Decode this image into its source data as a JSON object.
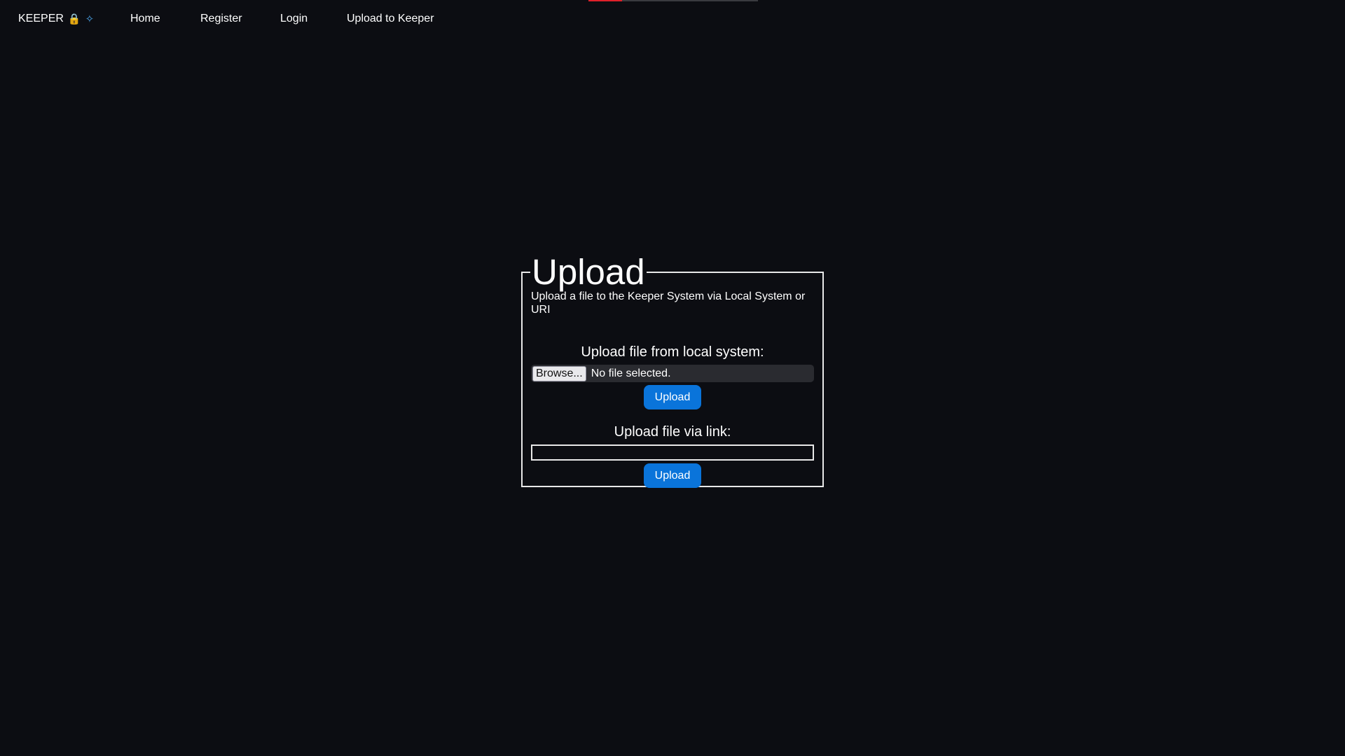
{
  "nav": {
    "brand": "KEEPER",
    "brand_icons": [
      "lock-icon",
      "paintbrush-icon"
    ],
    "links": [
      "Home",
      "Register",
      "Login",
      "Upload to Keeper"
    ]
  },
  "upload": {
    "title": "Upload",
    "description": "Upload a file to the Keeper System via Local System or URI",
    "local": {
      "label": "Upload file from local system:",
      "browse_label": "Browse...",
      "file_status": "No file selected.",
      "button_label": "Upload"
    },
    "link": {
      "label": "Upload file via link:",
      "value": "",
      "button_label": "Upload"
    }
  },
  "colors": {
    "background": "#0c0d12",
    "accent_button": "#0a74da",
    "text": "#ffffff",
    "border": "#e8e8e8"
  }
}
